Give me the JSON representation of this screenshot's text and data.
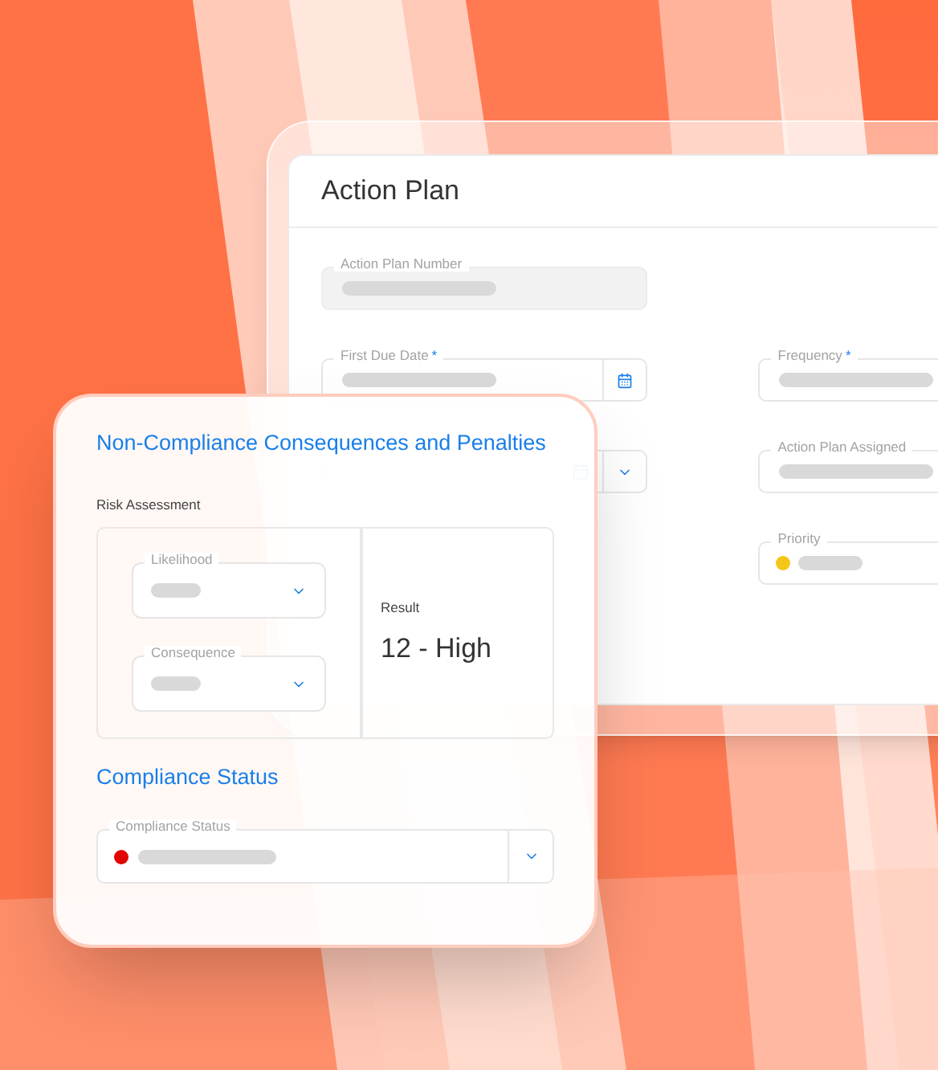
{
  "action_plan": {
    "title": "Action Plan",
    "left_fields": [
      {
        "kind": "text",
        "label": "Action Plan Number",
        "disabled": true
      },
      {
        "kind": "date",
        "label": "First Due Date",
        "required_mark": "*",
        "disabled": false
      },
      {
        "kind": "date-select",
        "disabled": false
      }
    ],
    "right_fields": [
      {
        "kind": "text",
        "label": "Frequency",
        "required_mark": "*",
        "disabled": false
      },
      {
        "kind": "text",
        "label": "Action Plan Assigned",
        "disabled": false
      },
      {
        "kind": "dot",
        "label": "Priority",
        "color": "#f5c518",
        "disabled": false
      }
    ]
  },
  "consequences": {
    "title": "Non-Compliance Consequences and Penalties",
    "risk_assessment": {
      "label": "Risk Assessment",
      "selects": [
        {
          "label": "Likelihood"
        },
        {
          "label": "Consequence"
        }
      ],
      "result_label": "Result",
      "result_value": "12 - High"
    },
    "status_heading": "Compliance Status",
    "status_field": {
      "label": "Compliance Status",
      "color": "#e10600"
    }
  }
}
